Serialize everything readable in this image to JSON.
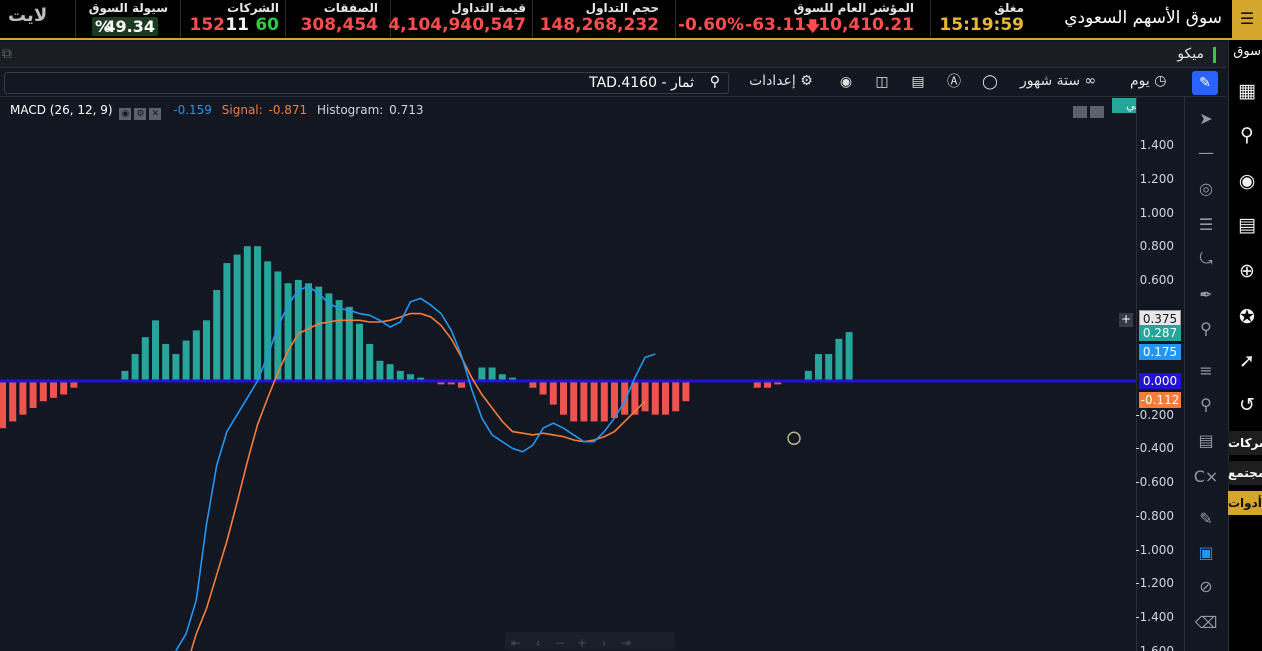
{
  "ticker": {
    "menu_icon": "menu-icon",
    "market_title": "سوق الأسهم السعودي",
    "status_label": "مغلق",
    "time": "15:19:59",
    "index_label": "المؤشر العام للسوق",
    "index_value": "10,410.21",
    "index_change": "-63.11",
    "index_change_pct": "-0.60%",
    "volume_label": "حجم التداول",
    "volume_value": "148,268,232",
    "turnover_label": "قيمة التداول",
    "turnover_value": "4,104,940,547",
    "deals_label": "الصفقات",
    "deals_value": "308,454",
    "companies_label": "الشركات",
    "companies_up": "60",
    "companies_unchanged": "11",
    "companies_down": "152",
    "liquidity_label": "سيولة السوق",
    "liquidity_value": "49.34",
    "liquidity_unit": "%",
    "lite_label": "لايت",
    "colors": {
      "accent": "#d4a72c",
      "down": "#ff4d4d",
      "up": "#2ecc40"
    }
  },
  "window": {
    "title": "ميكو"
  },
  "toolbar": {
    "symbol": "TAD.4160 - ثمار",
    "settings_label": "إعدادات",
    "range_label": "ستة شهور",
    "interval_label": "يوم"
  },
  "indicator": {
    "name": "MACD (26, 12, 9)",
    "macd_value": "-0.159",
    "signal_label": "Signal:",
    "signal_value": "-0.871",
    "histogram_label": "Histogram:",
    "histogram_value": "0.713",
    "auto_label": "رسوماتي"
  },
  "axis": {
    "ticks": [
      "1.400",
      "1.200",
      "1.000",
      "0.800",
      "0.600",
      "-0.200",
      "-0.400",
      "-0.600",
      "-0.800",
      "-1.000",
      "-1.200",
      "-1.400",
      "-1.600"
    ],
    "tags": [
      {
        "text": "0.375",
        "color": "#e8e8e8"
      },
      {
        "text": "0.287",
        "color": "#26a69a"
      },
      {
        "text": "0.175",
        "color": "#2196f3"
      },
      {
        "text": "0.000",
        "color": "#2212d6"
      },
      {
        "text": "-0.112",
        "color": "#f57c3b"
      }
    ]
  },
  "sidenav": {
    "title": "سوق",
    "items": [
      "شركات",
      "مجتمع",
      "أدوات"
    ]
  },
  "chart_data": {
    "type": "line",
    "ylim": [
      -1.6,
      1.5
    ],
    "histogram": [
      -0.28,
      -0.24,
      -0.2,
      -0.16,
      -0.12,
      -0.1,
      -0.08,
      -0.04,
      0,
      0,
      0,
      0,
      0.06,
      0.16,
      0.26,
      0.36,
      0.22,
      0.16,
      0.24,
      0.3,
      0.36,
      0.54,
      0.7,
      0.75,
      0.8,
      0.8,
      0.71,
      0.65,
      0.58,
      0.6,
      0.58,
      0.56,
      0.52,
      0.48,
      0.44,
      0.34,
      0.22,
      0.12,
      0.1,
      0.06,
      0.04,
      0.02,
      0,
      -0.02,
      -0.02,
      -0.04,
      0,
      0.08,
      0.08,
      0.04,
      0.02,
      0,
      -0.04,
      -0.08,
      -0.14,
      -0.2,
      -0.24,
      -0.24,
      -0.24,
      -0.24,
      -0.22,
      -0.2,
      -0.2,
      -0.18,
      -0.2,
      -0.2,
      -0.18,
      -0.12,
      0,
      0,
      0,
      0,
      0,
      0,
      -0.04,
      -0.04,
      -0.02,
      0,
      0,
      0.06,
      0.16,
      0.16,
      0.25,
      0.29
    ],
    "macd": [
      [
        17,
        -1.6
      ],
      [
        18,
        -1.5
      ],
      [
        19,
        -1.3
      ],
      [
        20,
        -0.85
      ],
      [
        21,
        -0.5
      ],
      [
        22,
        -0.3
      ],
      [
        23,
        -0.2
      ],
      [
        24,
        -0.1
      ],
      [
        25,
        0
      ],
      [
        26,
        0.15
      ],
      [
        27,
        0.32
      ],
      [
        28,
        0.45
      ],
      [
        29,
        0.54
      ],
      [
        30,
        0.56
      ],
      [
        31,
        0.52
      ],
      [
        32,
        0.46
      ],
      [
        33,
        0.43
      ],
      [
        34,
        0.42
      ],
      [
        35,
        0.4
      ],
      [
        36,
        0.39
      ],
      [
        37,
        0.36
      ],
      [
        38,
        0.32
      ],
      [
        39,
        0.35
      ],
      [
        40,
        0.47
      ],
      [
        41,
        0.49
      ],
      [
        42,
        0.45
      ],
      [
        43,
        0.4
      ],
      [
        44,
        0.3
      ],
      [
        45,
        0.15
      ],
      [
        46,
        -0.05
      ],
      [
        47,
        -0.22
      ],
      [
        48,
        -0.32
      ],
      [
        49,
        -0.36
      ],
      [
        50,
        -0.4
      ],
      [
        51,
        -0.42
      ],
      [
        52,
        -0.38
      ],
      [
        53,
        -0.28
      ],
      [
        54,
        -0.25
      ],
      [
        55,
        -0.28
      ],
      [
        56,
        -0.32
      ],
      [
        57,
        -0.36
      ],
      [
        58,
        -0.36
      ],
      [
        59,
        -0.3
      ],
      [
        60,
        -0.22
      ],
      [
        61,
        -0.12
      ],
      [
        62,
        0.02
      ],
      [
        63,
        0.14
      ],
      [
        64,
        0.16
      ]
    ],
    "signal": [
      [
        18,
        -1.7
      ],
      [
        19,
        -1.5
      ],
      [
        20,
        -1.35
      ],
      [
        21,
        -1.15
      ],
      [
        22,
        -0.95
      ],
      [
        23,
        -0.72
      ],
      [
        24,
        -0.48
      ],
      [
        25,
        -0.26
      ],
      [
        26,
        -0.1
      ],
      [
        27,
        0.05
      ],
      [
        28,
        0.18
      ],
      [
        29,
        0.28
      ],
      [
        30,
        0.31
      ],
      [
        31,
        0.34
      ],
      [
        32,
        0.35
      ],
      [
        33,
        0.36
      ],
      [
        34,
        0.36
      ],
      [
        35,
        0.36
      ],
      [
        36,
        0.35
      ],
      [
        37,
        0.35
      ],
      [
        38,
        0.36
      ],
      [
        39,
        0.38
      ],
      [
        40,
        0.4
      ],
      [
        41,
        0.4
      ],
      [
        42,
        0.38
      ],
      [
        43,
        0.33
      ],
      [
        44,
        0.25
      ],
      [
        45,
        0.14
      ],
      [
        46,
        0.02
      ],
      [
        47,
        -0.08
      ],
      [
        48,
        -0.16
      ],
      [
        49,
        -0.24
      ],
      [
        50,
        -0.3
      ],
      [
        51,
        -0.31
      ],
      [
        52,
        -0.32
      ],
      [
        53,
        -0.31
      ],
      [
        54,
        -0.32
      ],
      [
        55,
        -0.33
      ],
      [
        56,
        -0.35
      ],
      [
        57,
        -0.36
      ],
      [
        58,
        -0.35
      ],
      [
        59,
        -0.33
      ],
      [
        60,
        -0.3
      ],
      [
        61,
        -0.24
      ],
      [
        62,
        -0.18
      ],
      [
        63,
        -0.12
      ]
    ],
    "colors": {
      "histogram_up": "#26a69a",
      "histogram_down": "#ef5350",
      "macd": "#2196f3",
      "signal": "#f57c3b",
      "zero_line": "#2212d6"
    }
  }
}
